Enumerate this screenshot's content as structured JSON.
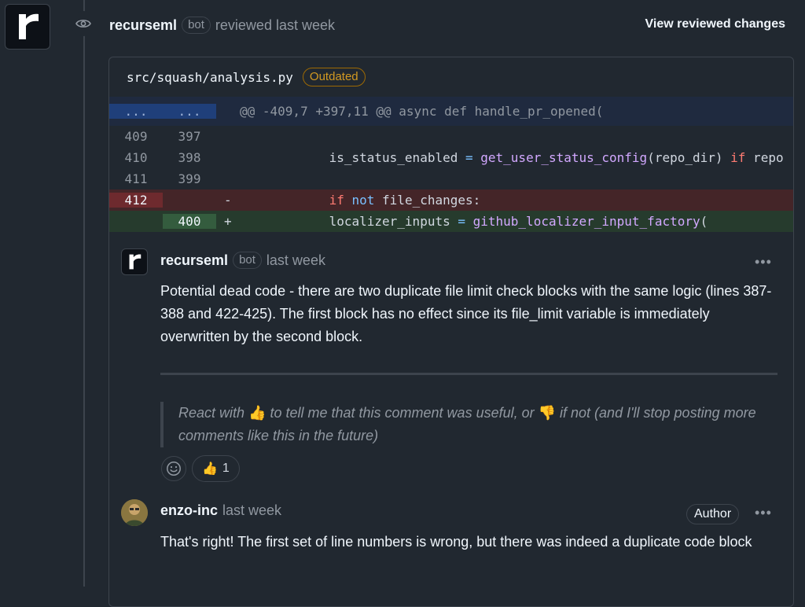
{
  "review": {
    "author": "recurseml",
    "bot_label": "bot",
    "action": "reviewed last week",
    "view_changes": "View reviewed changes"
  },
  "file": {
    "path": "src/squash/analysis.py",
    "status": "Outdated"
  },
  "diff": {
    "hunk": {
      "old": "...",
      "new": "...",
      "header": "@@ -409,7 +397,11 @@ async def handle_pr_opened("
    },
    "rows": [
      {
        "old": "409",
        "new": "397",
        "sign": "",
        "type": "context"
      },
      {
        "old": "410",
        "new": "398",
        "sign": "",
        "type": "context"
      },
      {
        "old": "411",
        "new": "399",
        "sign": "",
        "type": "context"
      },
      {
        "old": "412",
        "new": "",
        "sign": "-",
        "type": "del"
      },
      {
        "old": "",
        "new": "400",
        "sign": "+",
        "type": "add"
      }
    ],
    "tokens": {
      "r1_var": "is_status_enabled",
      "r1_eq": " = ",
      "r1_fn": "get_user_status_config",
      "r1_args": "(repo_dir) ",
      "r1_if": "if",
      "r1_tail": " repo",
      "r3_if": "if",
      "r3_not": "not",
      "r3_rest": " file_changes:",
      "r4_var": "localizer_inputs",
      "r4_eq": " = ",
      "r4_fn": "github_localizer_input_factory",
      "r4_rest": "("
    }
  },
  "comment1": {
    "author": "recurseml",
    "bot_label": "bot",
    "time": "last week",
    "more": "•••",
    "body": "Potential dead code - there are two duplicate file limit check blocks with the same logic (lines 387-388 and 422-425). The first block has no effect since its file_limit variable is immediately overwritten by the second block.",
    "quote_pre": "React with ",
    "quote_thumbs_up": "👍",
    "quote_mid": " to tell me that this comment was useful, or ",
    "quote_thumbs_down": "👎",
    "quote_post": " if not (and I'll stop posting more comments like this in the future)",
    "reaction_emoji": "👍",
    "reaction_count": "1"
  },
  "comment2": {
    "author": "enzo-inc",
    "time": "last week",
    "role": "Author",
    "more": "•••",
    "body": "That's right! The first set of line numbers is wrong, but there was indeed a duplicate code block"
  }
}
